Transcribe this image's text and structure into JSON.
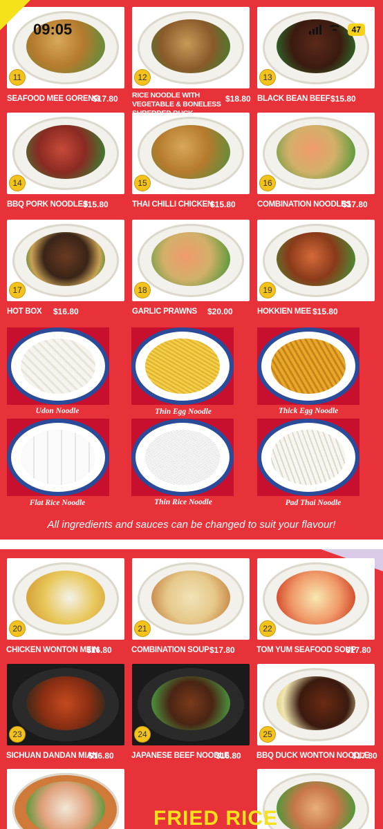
{
  "status_bar": {
    "time": "09:05",
    "battery": "47"
  },
  "dishes_top": [
    {
      "num": "11",
      "name": "SEAFOOD MEE GORENG",
      "price": "$17.80"
    },
    {
      "num": "12",
      "name": "RICE NOODLE WITH VEGETABLE & BONELESS SHREDDED DUCK",
      "price": "$18.80"
    },
    {
      "num": "13",
      "name": "BLACK BEAN BEEF",
      "price": "$15.80"
    },
    {
      "num": "14",
      "name": "BBQ PORK NOODLES",
      "price": "$15.80"
    },
    {
      "num": "15",
      "name": "THAI CHILLI CHICKEN",
      "price": "$15.80"
    },
    {
      "num": "16",
      "name": "COMBINATION NOODLES",
      "price": "$17.80"
    },
    {
      "num": "17",
      "name": "HOT BOX",
      "price": "$16.80"
    },
    {
      "num": "18",
      "name": "GARLIC PRAWNS",
      "price": "$20.00"
    },
    {
      "num": "19",
      "name": "HOKKIEN MEE",
      "price": "$15.80"
    }
  ],
  "noodle_types": [
    "Udon Noodle",
    "Thin Egg Noodle",
    "Thick Egg Noodle",
    "Flat Rice Noodle",
    "Thin Rice Noodle",
    "Pad Thai Noodle"
  ],
  "note": "All ingredients and sauces can be changed to suit your flavour!",
  "dishes_soup": [
    {
      "num": "20",
      "name": "CHICKEN WONTON MEIN",
      "price": "$16.80"
    },
    {
      "num": "21",
      "name": "COMBINATION SOUP",
      "price": "$17.80"
    },
    {
      "num": "22",
      "name": "TOM YUM SEAFOOD SOUP",
      "price": "$17.80"
    },
    {
      "num": "23",
      "name": "SICHUAN DANDAN MIAN",
      "price": "$16.80"
    },
    {
      "num": "24",
      "name": "JAPANESE BEEF NOODLE",
      "price": "$16.80"
    },
    {
      "num": "25",
      "name": "BBQ DUCK WONTON NOODLE",
      "price": "$17.80"
    }
  ],
  "fried_rice_title": "FRIED RICE"
}
